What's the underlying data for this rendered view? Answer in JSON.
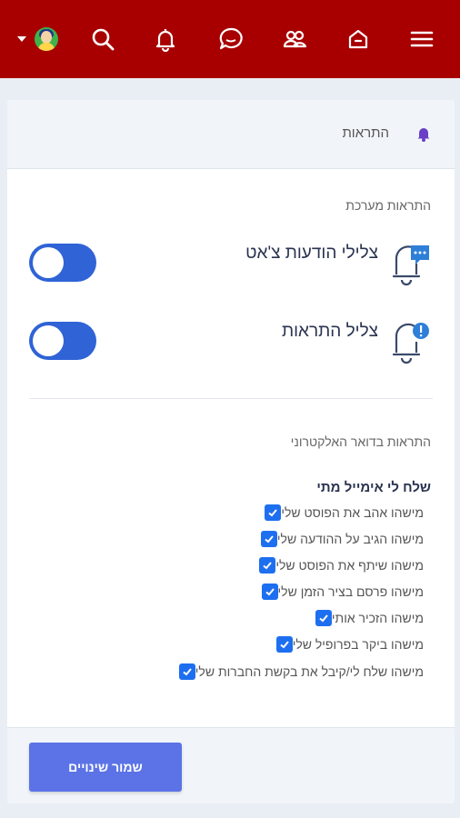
{
  "header": {
    "background": "#a80000",
    "icons": [
      "dropdown-caret",
      "avatar",
      "search-icon",
      "bell-icon",
      "chat-icon",
      "friends-icon",
      "home-icon",
      "menu-icon"
    ]
  },
  "card": {
    "title": "התראות",
    "system_label": "התראות מערכת",
    "settings": [
      {
        "label": "צלילי הודעות צ'אט",
        "enabled": true
      },
      {
        "label": "צליל התראות",
        "enabled": true
      }
    ],
    "email_label": "התראות בדואר האלקטרוני",
    "email_subhead": "שלח לי אימייל מתי",
    "email_options": [
      "מישהו אהב את הפוסט שלי",
      "מישהו הגיב על ההודעה שלי",
      "מישהו שיתף את הפוסט שלי",
      "מישהו פרסם בציר הזמן שלי",
      "מישהו הזכיר אותי",
      "מישהו ביקר בפרופיל שלי",
      "מישהו שלח לי/קיבל את בקשת החברות שלי"
    ],
    "save_label": "שמור שינויים"
  },
  "colors": {
    "accent": "#2f63d6",
    "checkbox": "#1e6ff0",
    "button": "#5b73e6"
  }
}
